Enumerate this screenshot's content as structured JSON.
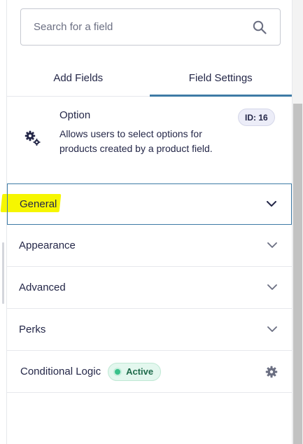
{
  "search": {
    "placeholder": "Search for a field"
  },
  "tabs": [
    {
      "label": "Add Fields",
      "active": false
    },
    {
      "label": "Field Settings",
      "active": true
    }
  ],
  "field": {
    "title": "Option",
    "description": "Allows users to select options for products created by a product field.",
    "id_badge": "ID: 16",
    "icon": "gears-icon"
  },
  "sections": [
    {
      "label": "General",
      "expanded_focus": true,
      "highlighted": true
    },
    {
      "label": "Appearance"
    },
    {
      "label": "Advanced"
    },
    {
      "label": "Perks"
    }
  ],
  "conditional_logic": {
    "label": "Conditional Logic",
    "status": "Active",
    "status_color": "#38c18a"
  },
  "colors": {
    "accent": "#3e7ba6",
    "text": "#242748",
    "highlight": "#f6f600"
  }
}
